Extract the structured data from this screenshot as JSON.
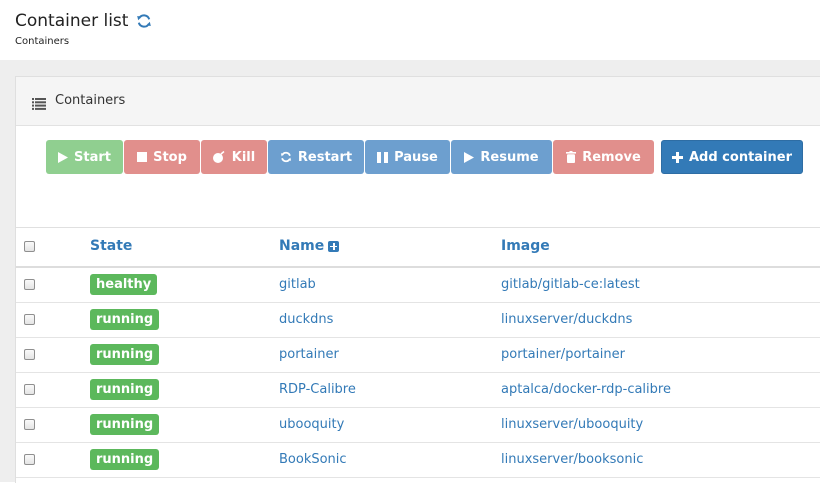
{
  "header": {
    "title": "Container list",
    "subtitle": "Containers"
  },
  "panel": {
    "title": "Containers"
  },
  "toolbar": {
    "start": "Start",
    "stop": "Stop",
    "kill": "Kill",
    "restart": "Restart",
    "pause": "Pause",
    "resume": "Resume",
    "remove": "Remove",
    "add_container": "Add container"
  },
  "table": {
    "columns": {
      "state": "State",
      "name": "Name",
      "image": "Image"
    },
    "rows": [
      {
        "state": "healthy",
        "name": "gitlab",
        "image": "gitlab/gitlab-ce:latest"
      },
      {
        "state": "running",
        "name": "duckdns",
        "image": "linuxserver/duckdns"
      },
      {
        "state": "running",
        "name": "portainer",
        "image": "portainer/portainer"
      },
      {
        "state": "running",
        "name": "RDP-Calibre",
        "image": "aptalca/docker-rdp-calibre"
      },
      {
        "state": "running",
        "name": "ubooquity",
        "image": "linuxserver/ubooquity"
      },
      {
        "state": "running",
        "name": "BookSonic",
        "image": "linuxserver/booksonic"
      }
    ]
  },
  "colors": {
    "primary": "#337ab7",
    "success": "#5cb85c",
    "danger_muted": "#e18f8c",
    "info_muted": "#6d9fcf",
    "success_muted": "#90cf90"
  },
  "icons": {
    "refresh": "refresh-icon",
    "list": "list-icon",
    "play": "play-icon",
    "stop": "stop-square-icon",
    "kill": "bomb-icon",
    "restart": "refresh-icon",
    "pause": "pause-icon",
    "resume": "play-icon",
    "remove": "trash-icon",
    "add": "plus-icon",
    "sort": "plus-square-icon"
  }
}
